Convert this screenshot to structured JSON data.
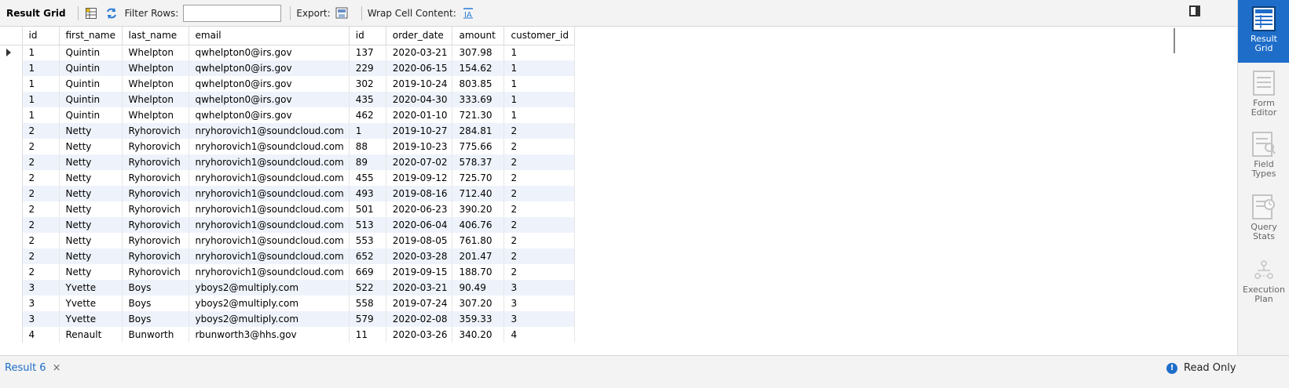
{
  "toolbar": {
    "result_grid_label": "Result Grid",
    "filter_rows_label": "Filter Rows:",
    "filter_value": "",
    "export_label": "Export:",
    "wrap_label": "Wrap Cell Content:"
  },
  "columns": [
    "id",
    "first_name",
    "last_name",
    "email",
    "id",
    "order_date",
    "amount",
    "customer_id"
  ],
  "rows": [
    [
      "1",
      "Quintin",
      "Whelpton",
      "qwhelpton0@irs.gov",
      "137",
      "2020-03-21",
      "307.98",
      "1"
    ],
    [
      "1",
      "Quintin",
      "Whelpton",
      "qwhelpton0@irs.gov",
      "229",
      "2020-06-15",
      "154.62",
      "1"
    ],
    [
      "1",
      "Quintin",
      "Whelpton",
      "qwhelpton0@irs.gov",
      "302",
      "2019-10-24",
      "803.85",
      "1"
    ],
    [
      "1",
      "Quintin",
      "Whelpton",
      "qwhelpton0@irs.gov",
      "435",
      "2020-04-30",
      "333.69",
      "1"
    ],
    [
      "1",
      "Quintin",
      "Whelpton",
      "qwhelpton0@irs.gov",
      "462",
      "2020-01-10",
      "721.30",
      "1"
    ],
    [
      "2",
      "Netty",
      "Ryhorovich",
      "nryhorovich1@soundcloud.com",
      "1",
      "2019-10-27",
      "284.81",
      "2"
    ],
    [
      "2",
      "Netty",
      "Ryhorovich",
      "nryhorovich1@soundcloud.com",
      "88",
      "2019-10-23",
      "775.66",
      "2"
    ],
    [
      "2",
      "Netty",
      "Ryhorovich",
      "nryhorovich1@soundcloud.com",
      "89",
      "2020-07-02",
      "578.37",
      "2"
    ],
    [
      "2",
      "Netty",
      "Ryhorovich",
      "nryhorovich1@soundcloud.com",
      "455",
      "2019-09-12",
      "725.70",
      "2"
    ],
    [
      "2",
      "Netty",
      "Ryhorovich",
      "nryhorovich1@soundcloud.com",
      "493",
      "2019-08-16",
      "712.40",
      "2"
    ],
    [
      "2",
      "Netty",
      "Ryhorovich",
      "nryhorovich1@soundcloud.com",
      "501",
      "2020-06-23",
      "390.20",
      "2"
    ],
    [
      "2",
      "Netty",
      "Ryhorovich",
      "nryhorovich1@soundcloud.com",
      "513",
      "2020-06-04",
      "406.76",
      "2"
    ],
    [
      "2",
      "Netty",
      "Ryhorovich",
      "nryhorovich1@soundcloud.com",
      "553",
      "2019-08-05",
      "761.80",
      "2"
    ],
    [
      "2",
      "Netty",
      "Ryhorovich",
      "nryhorovich1@soundcloud.com",
      "652",
      "2020-03-28",
      "201.47",
      "2"
    ],
    [
      "2",
      "Netty",
      "Ryhorovich",
      "nryhorovich1@soundcloud.com",
      "669",
      "2019-09-15",
      "188.70",
      "2"
    ],
    [
      "3",
      "Yvette",
      "Boys",
      "yboys2@multiply.com",
      "522",
      "2020-03-21",
      "90.49",
      "3"
    ],
    [
      "3",
      "Yvette",
      "Boys",
      "yboys2@multiply.com",
      "558",
      "2019-07-24",
      "307.20",
      "3"
    ],
    [
      "3",
      "Yvette",
      "Boys",
      "yboys2@multiply.com",
      "579",
      "2020-02-08",
      "359.33",
      "3"
    ],
    [
      "4",
      "Renault",
      "Bunworth",
      "rbunworth3@hhs.gov",
      "11",
      "2020-03-26",
      "340.20",
      "4"
    ]
  ],
  "selected_row_index": 0,
  "side_panel": {
    "result_grid": "Result Grid",
    "form_editor": "Form Editor",
    "field_types": "Field Types",
    "query_stats": "Query Stats",
    "execution_plan": "Execution Plan"
  },
  "bottom": {
    "tab_label": "Result 6",
    "close_glyph": "×",
    "status_label": "Read Only"
  },
  "icons": {
    "grid": "grid-icon",
    "refresh": "refresh-icon",
    "export": "export-icon",
    "wrap": "wrap-icon",
    "panel_toggle": "panel-toggle-icon",
    "info": "info-icon"
  },
  "colors": {
    "accent": "#1e6dc9",
    "row_alt": "#eef3fb"
  }
}
